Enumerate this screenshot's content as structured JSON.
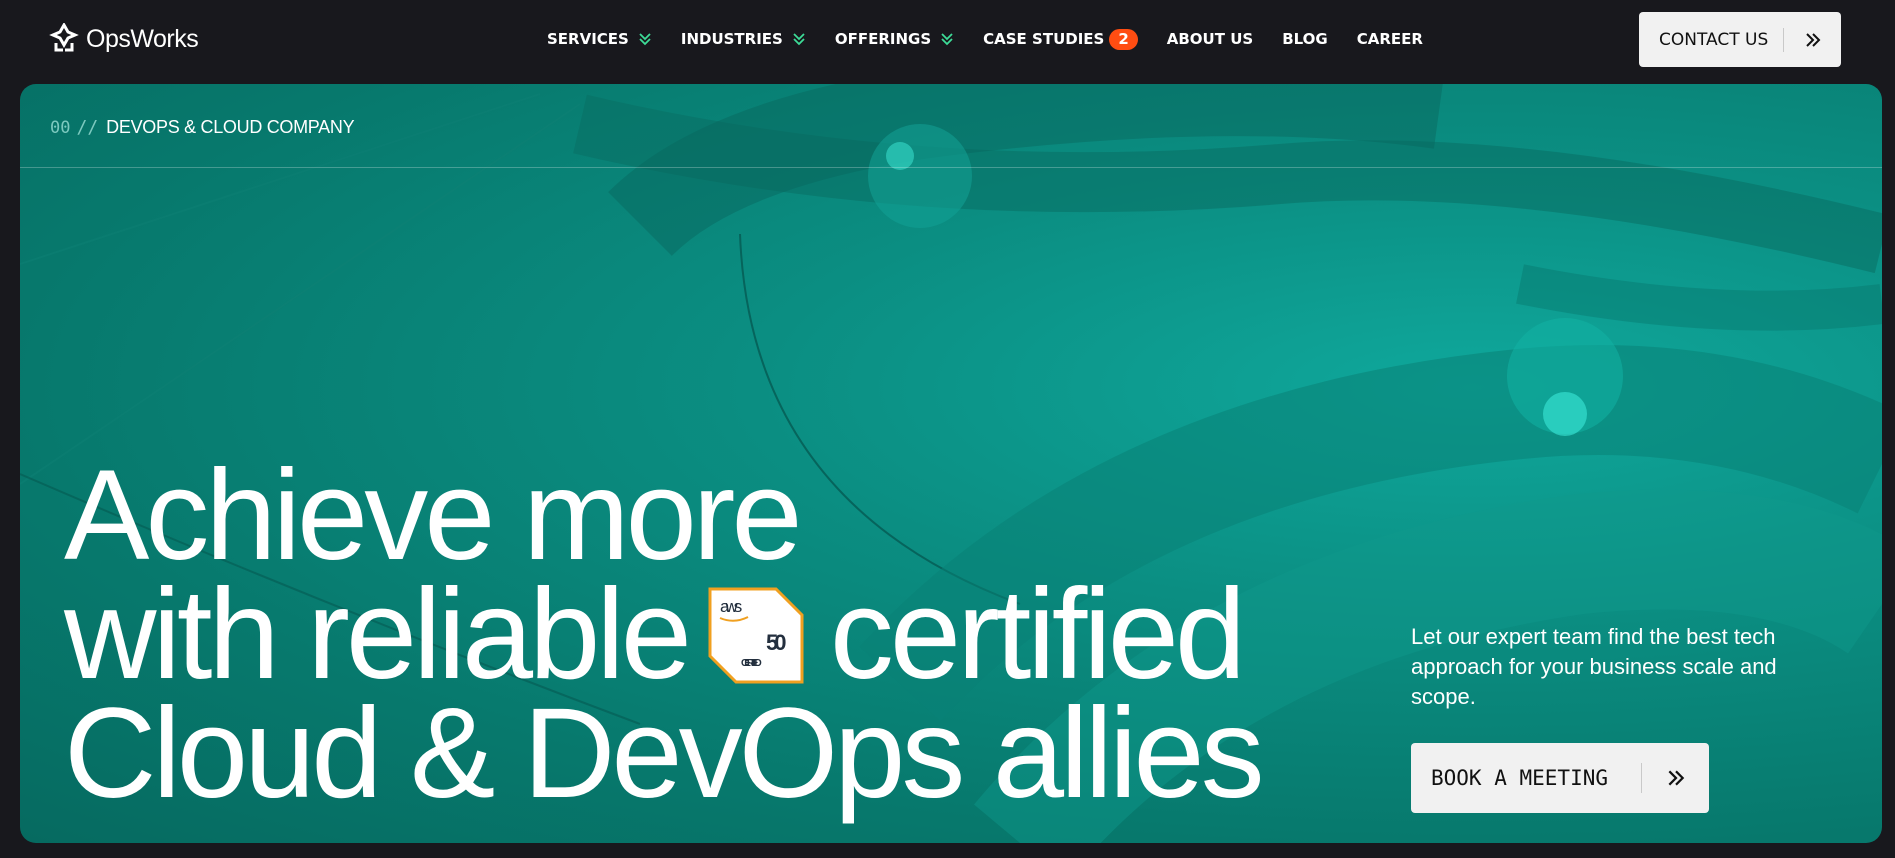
{
  "header": {
    "logo_text": "OpsWorks",
    "nav": [
      {
        "label": "SERVICES",
        "has_dropdown": true
      },
      {
        "label": "INDUSTRIES",
        "has_dropdown": true
      },
      {
        "label": "OFFERINGS",
        "has_dropdown": true
      },
      {
        "label": "CASE STUDIES",
        "badge": "2"
      },
      {
        "label": "ABOUT US"
      },
      {
        "label": "BLOG"
      },
      {
        "label": "CAREER"
      }
    ],
    "contact_label": "CONTACT US"
  },
  "hero": {
    "breadcrumb_number": "00",
    "breadcrumb_sep": "//",
    "breadcrumb_label": "DEVOPS & CLOUD COMPANY",
    "headline_line1": "Achieve more",
    "headline_line2a": "with reliable",
    "headline_line2b": "certified",
    "headline_line3": "Cloud & DevOps allies",
    "aws_badge": {
      "brand": "aws",
      "number": "50",
      "label": "CERTIFIED"
    },
    "subtitle": "Let our expert team find the best tech approach for your business scale and scope.",
    "cta_label": "BOOK A MEETING"
  },
  "colors": {
    "background": "#18181d",
    "hero": "#0b8e82",
    "accent_chevron": "#3ddc97",
    "badge": "#ff4d12",
    "aws_orange": "#f0a020",
    "button": "#f1f1f1"
  }
}
